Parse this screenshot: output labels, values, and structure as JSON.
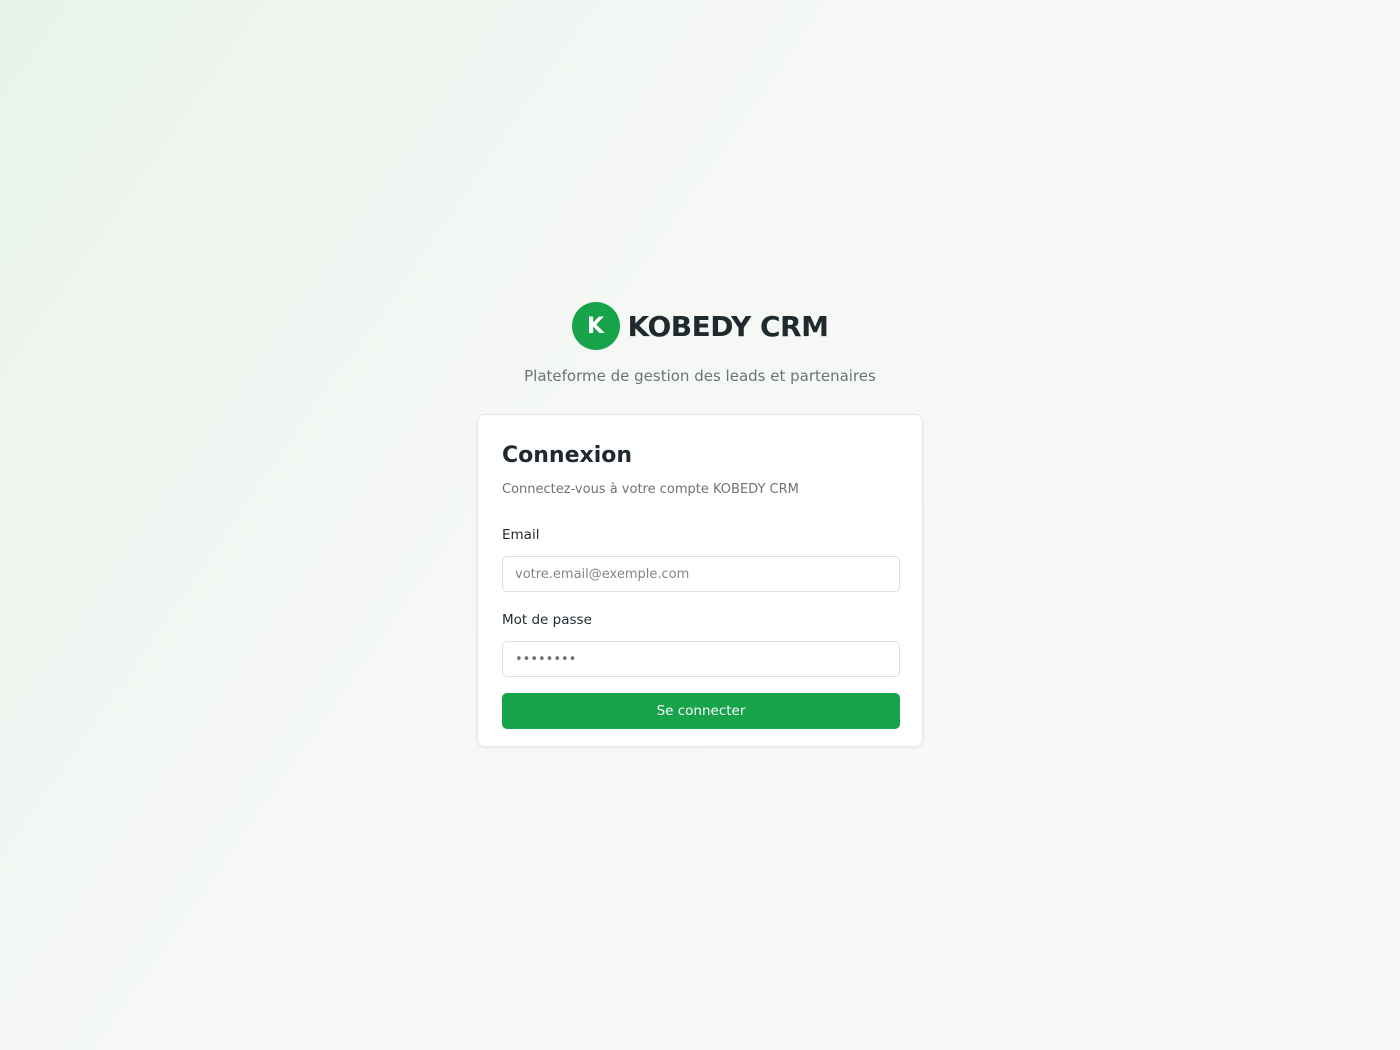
{
  "brand": {
    "logo_letter": "K",
    "name": "KOBEDY CRM",
    "tagline": "Plateforme de gestion des leads et partenaires",
    "accent_color": "#16a34a"
  },
  "login": {
    "title": "Connexion",
    "subtitle": "Connectez-vous à votre compte KOBEDY CRM",
    "email_label": "Email",
    "email_placeholder": "votre.email@exemple.com",
    "email_value": "",
    "password_label": "Mot de passe",
    "password_value": "••••••••",
    "submit_label": "Se connecter"
  }
}
